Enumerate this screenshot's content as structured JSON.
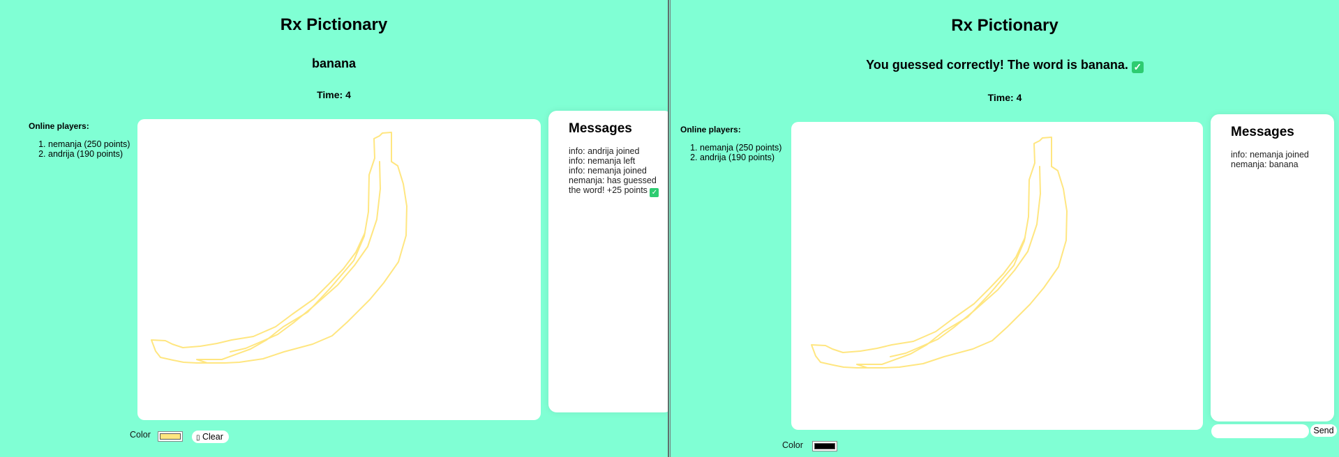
{
  "left": {
    "title": "Rx Pictionary",
    "word": "banana",
    "timer": "Time: 4",
    "players_heading": "Online players:",
    "players": [
      "nemanja (250 points)",
      "andrija (190 points)"
    ],
    "messages_title": "Messages",
    "messages": [
      "info: andrija joined",
      "info: nemanja left",
      "info: nemanja joined",
      "nemanja: has guessed the word! +25 points"
    ],
    "color_label": "Color",
    "selected_color": "#ffe680",
    "clear_label": "Clear",
    "trash_icon": "trash-icon"
  },
  "right": {
    "title": "Rx Pictionary",
    "result": "You guessed correctly! The word is banana.",
    "timer": "Time: 4",
    "players_heading": "Online players:",
    "players": [
      "nemanja (250 points)",
      "andrija (190 points)"
    ],
    "messages_title": "Messages",
    "messages": [
      "info: nemanja joined",
      "nemanja: banana"
    ],
    "color_label": "Color",
    "selected_color": "#000000",
    "send_label": "Send",
    "chat_input_value": ""
  },
  "colors": {
    "background": "#80ffd4",
    "stroke": "#ffe680",
    "check": "#2ecc71"
  }
}
